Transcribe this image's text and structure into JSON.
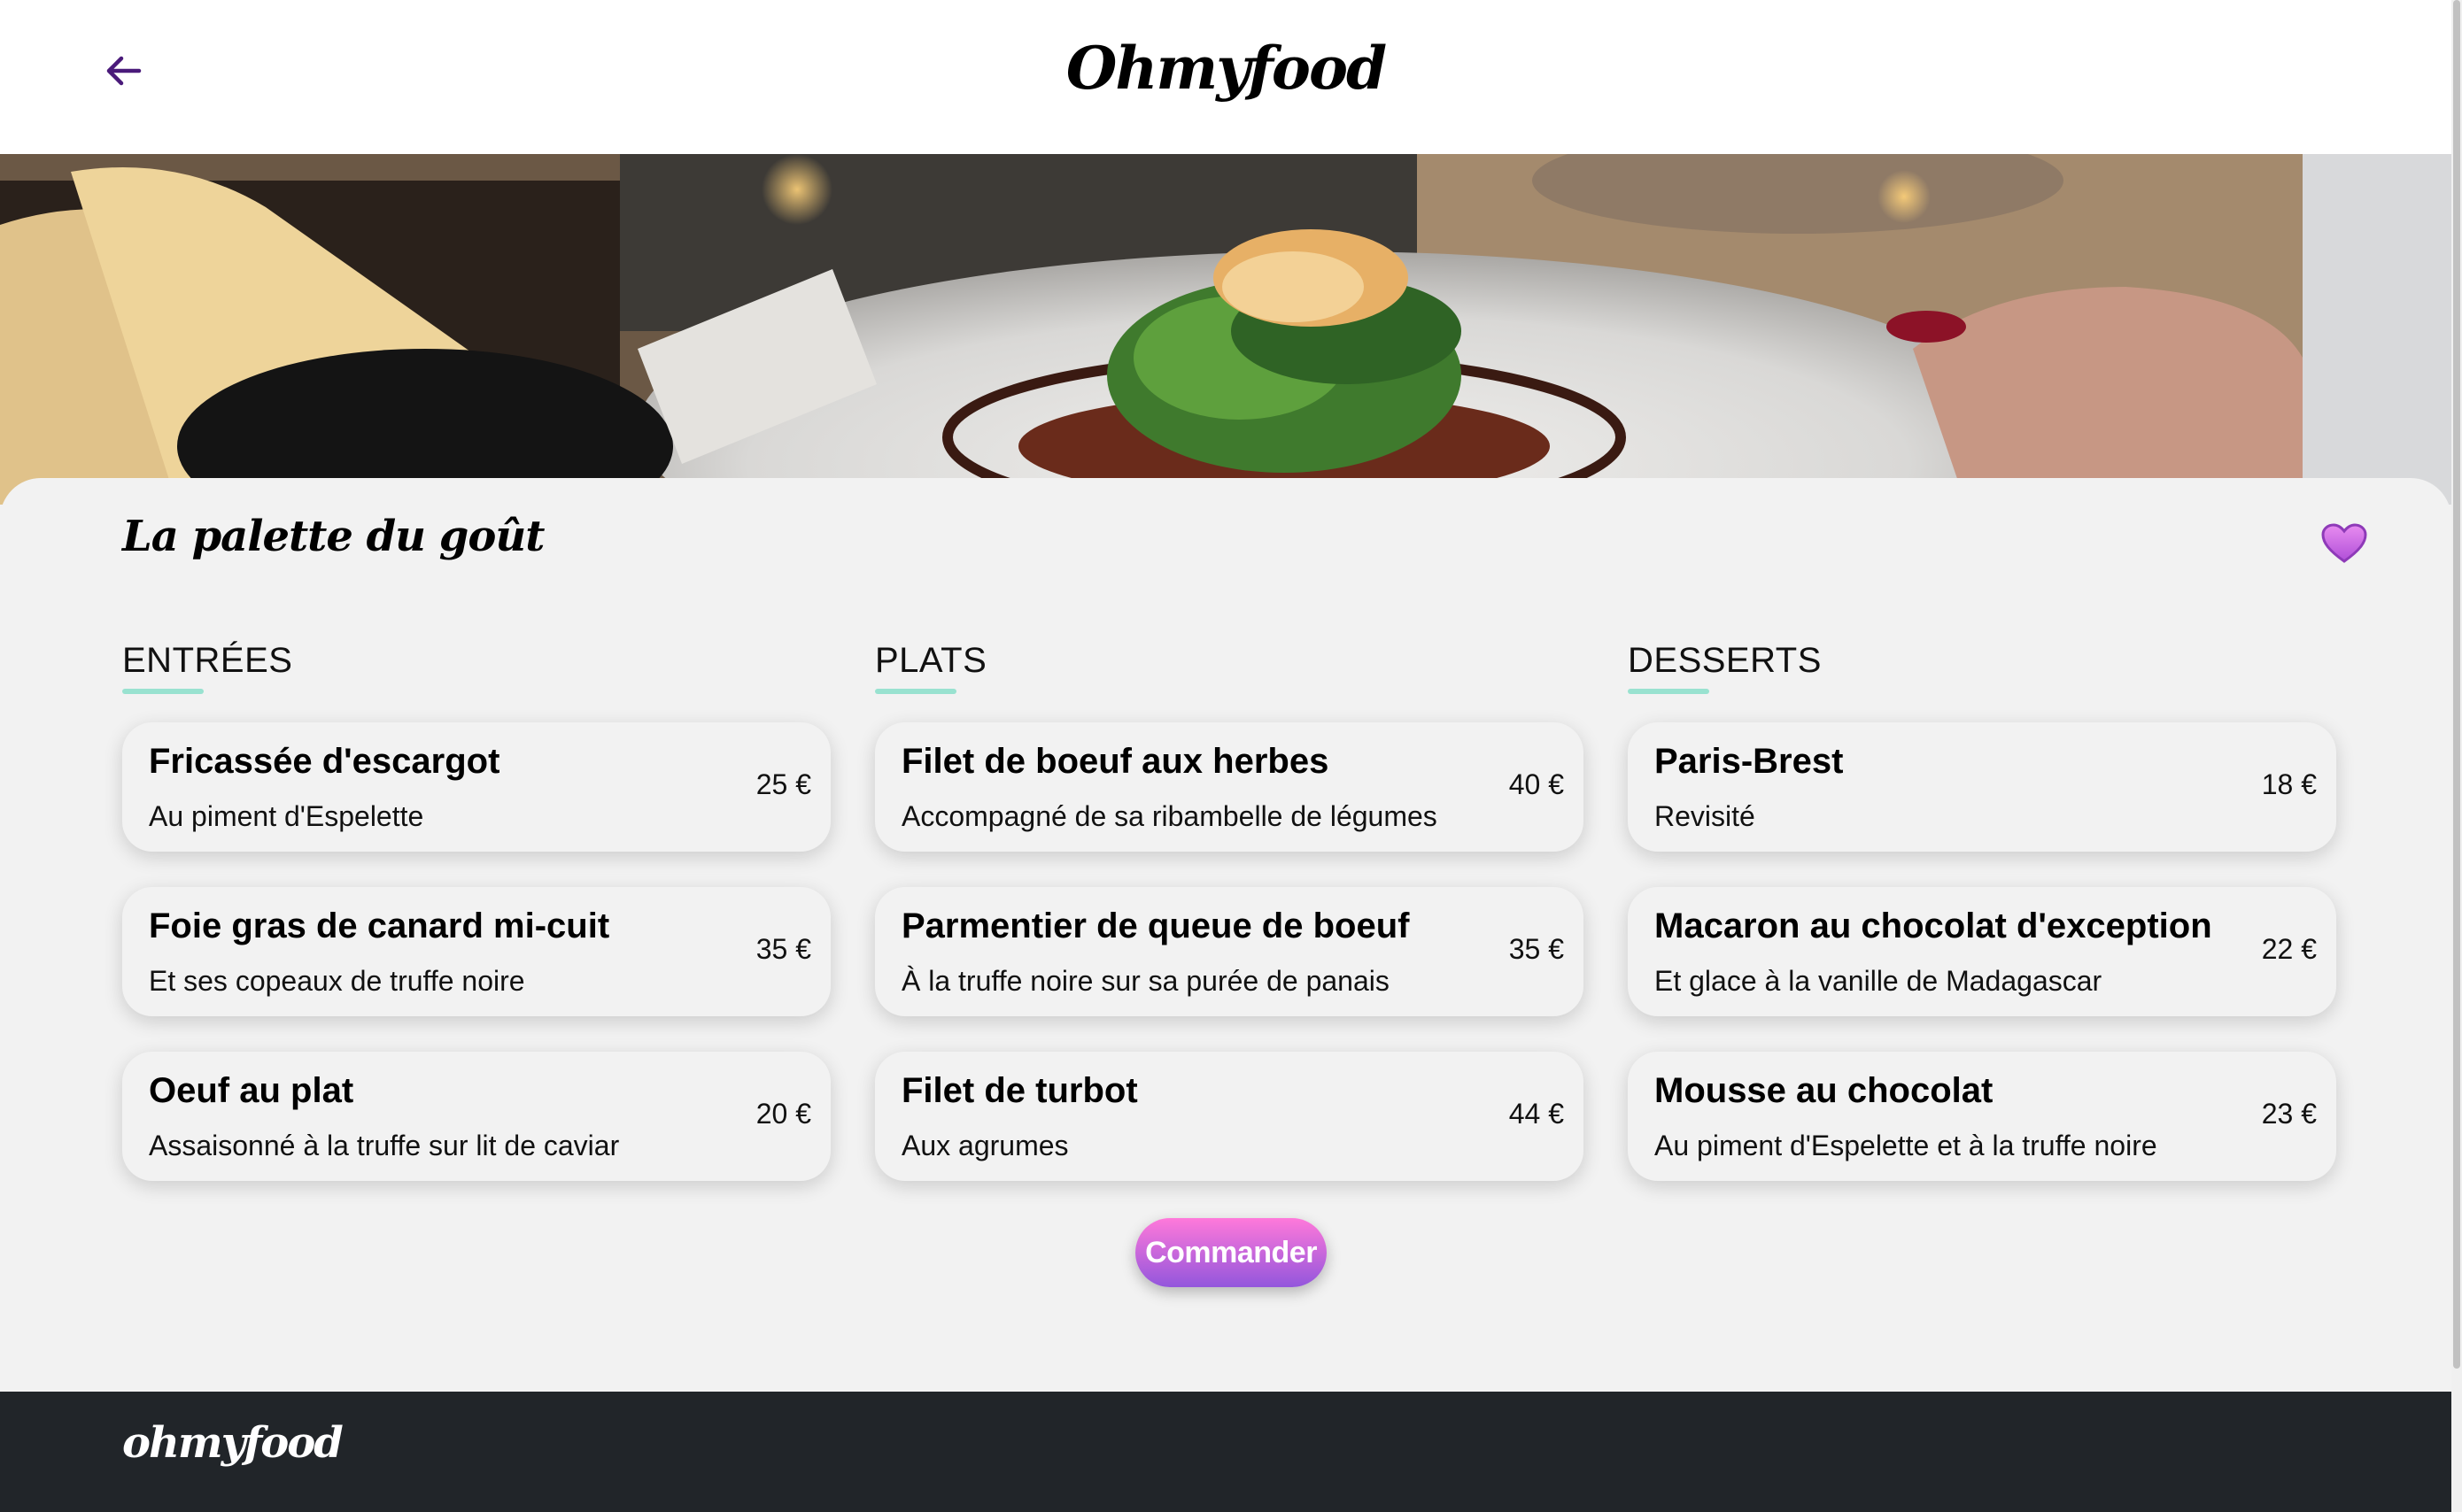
{
  "header": {
    "title": "Ohmyfood",
    "back_icon": "arrow-left-icon"
  },
  "hero": {
    "image": "plated-dish-photo"
  },
  "restaurant": {
    "name": "La palette du goût",
    "favorite_icon": "heart-icon"
  },
  "menu": {
    "sections": [
      {
        "title": "ENTRÉES",
        "items": [
          {
            "name": "Fricassée d'escargot",
            "description": "Au piment d'Espelette",
            "price": "25 €"
          },
          {
            "name": "Foie gras de canard mi-cuit",
            "description": "Et ses copeaux de truffe noire",
            "price": "35 €"
          },
          {
            "name": "Oeuf au plat",
            "description": "Assaisonné à la truffe sur lit de caviar",
            "price": "20 €"
          }
        ]
      },
      {
        "title": "PLATS",
        "items": [
          {
            "name": "Filet de boeuf aux herbes",
            "description": "Accompagné de sa ribambelle de légumes",
            "price": "40 €"
          },
          {
            "name": "Parmentier de queue de boeuf",
            "description": "À la truffe noire sur sa purée de panais",
            "price": "35 €"
          },
          {
            "name": "Filet de turbot",
            "description": "Aux agrumes",
            "price": "44 €"
          }
        ]
      },
      {
        "title": "DESSERTS",
        "items": [
          {
            "name": "Paris-Brest",
            "description": "Revisité",
            "price": "18 €"
          },
          {
            "name": "Macaron au chocolat d'exception",
            "description": "Et glace à la vanille de Madagascar",
            "price": "22 €"
          },
          {
            "name": "Mousse au chocolat",
            "description": "Au piment d'Espelette et à la truffe noire",
            "price": "23 €"
          }
        ]
      }
    ]
  },
  "order_button": {
    "label": "Commander"
  },
  "footer": {
    "logo": "ohmyfood"
  },
  "colors": {
    "accent_underline": "#99e2d0",
    "button_gradient_top": "#ff79da",
    "button_gradient_bottom": "#9356dc",
    "back_arrow": "#4a1a7a",
    "heart": "#cf6ee8",
    "footer_bg": "#212529"
  }
}
